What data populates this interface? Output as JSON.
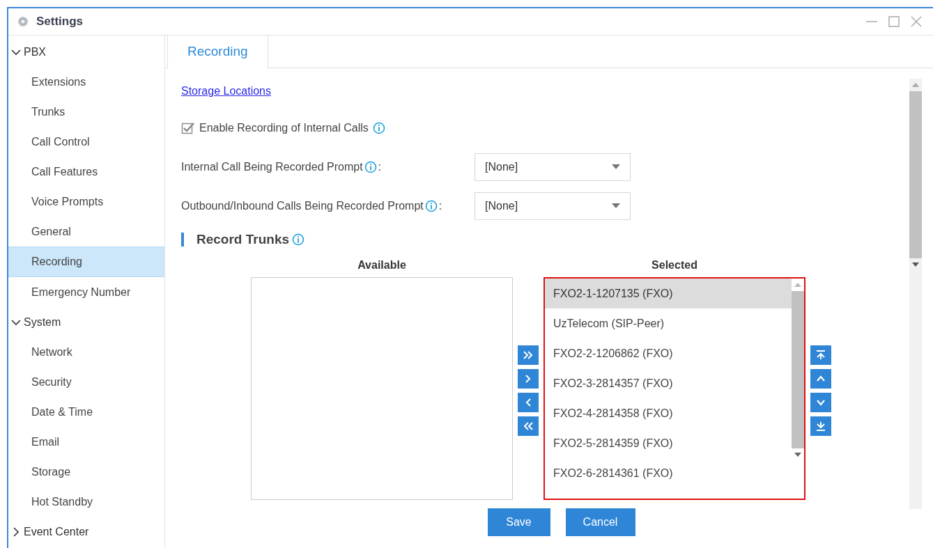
{
  "window": {
    "title": "Settings"
  },
  "sidebar": {
    "items": [
      {
        "label": "PBX",
        "expanded": true,
        "children": [
          {
            "label": "Extensions",
            "selected": false
          },
          {
            "label": "Trunks",
            "selected": false
          },
          {
            "label": "Call Control",
            "selected": false
          },
          {
            "label": "Call Features",
            "selected": false
          },
          {
            "label": "Voice Prompts",
            "selected": false
          },
          {
            "label": "General",
            "selected": false
          },
          {
            "label": "Recording",
            "selected": true
          },
          {
            "label": "Emergency Number",
            "selected": false
          }
        ]
      },
      {
        "label": "System",
        "expanded": true,
        "children": [
          {
            "label": "Network",
            "selected": false
          },
          {
            "label": "Security",
            "selected": false
          },
          {
            "label": "Date & Time",
            "selected": false
          },
          {
            "label": "Email",
            "selected": false
          },
          {
            "label": "Storage",
            "selected": false
          },
          {
            "label": "Hot Standby",
            "selected": false
          }
        ]
      },
      {
        "label": "Event Center",
        "expanded": false
      }
    ]
  },
  "tabs": [
    {
      "label": "Recording",
      "selected": true
    }
  ],
  "storage_link": "Storage Locations",
  "enable_internal": {
    "label": "Enable Recording of Internal Calls",
    "checked": true
  },
  "prompts": [
    {
      "label": "Internal Call Being Recorded Prompt",
      "colon": ":",
      "value": "[None]"
    },
    {
      "label": "Outbound/Inbound Calls Being Recorded Prompt",
      "colon": ":",
      "value": "[None]"
    }
  ],
  "record_trunks": {
    "title": "Record Trunks",
    "available_heading": "Available",
    "selected_heading": "Selected",
    "selected_items": [
      {
        "label": "FXO2-1-1207135 (FXO)",
        "selected": true
      },
      {
        "label": "UzTelecom (SIP-Peer)",
        "selected": false
      },
      {
        "label": "FXO2-2-1206862 (FXO)",
        "selected": false
      },
      {
        "label": "FXO2-3-2814357 (FXO)",
        "selected": false
      },
      {
        "label": "FXO2-4-2814358 (FXO)",
        "selected": false
      },
      {
        "label": "FXO2-5-2814359 (FXO)",
        "selected": false
      },
      {
        "label": "FXO2-6-2814361 (FXO)",
        "selected": false
      }
    ]
  },
  "buttons": [
    "Save",
    "Cancel"
  ]
}
